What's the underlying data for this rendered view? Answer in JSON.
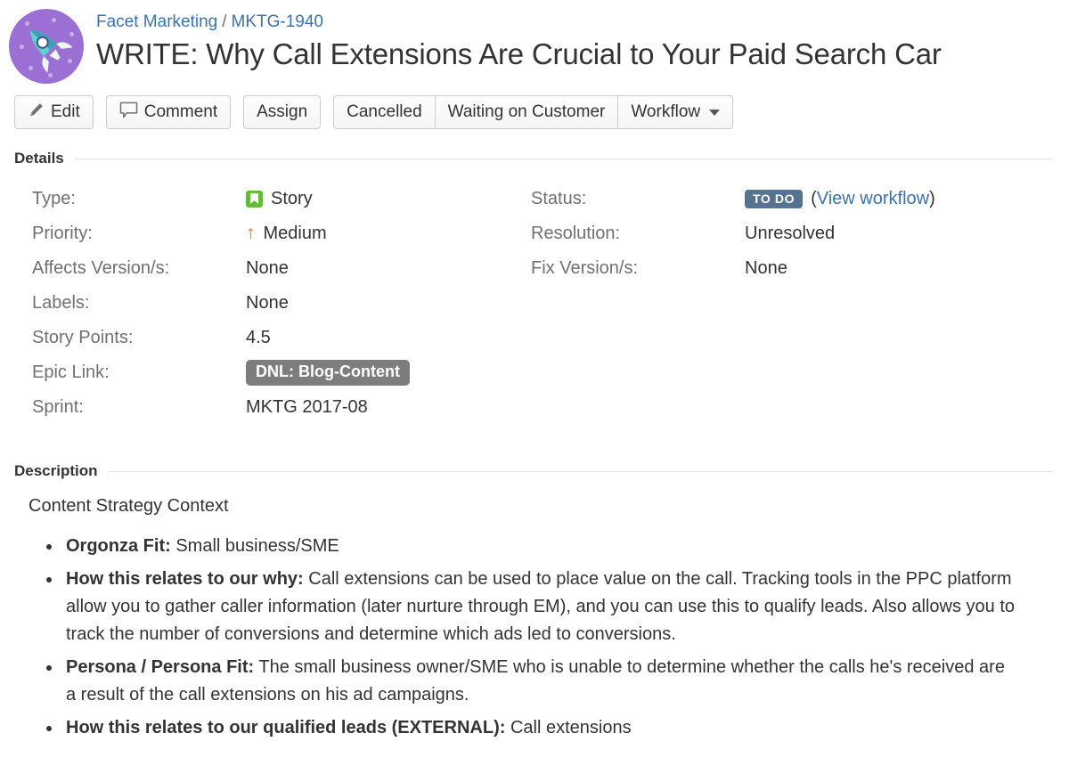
{
  "header": {
    "avatar_icon": "rocket-avatar-icon",
    "breadcrumb": {
      "project": "Facet Marketing",
      "separator": "/",
      "issue_key": "MKTG-1940"
    },
    "title": "WRITE: Why Call Extensions Are Crucial to Your Paid Search Car"
  },
  "toolbar": {
    "edit_label": "Edit",
    "edit_icon": "pencil-icon",
    "comment_label": "Comment",
    "comment_icon": "speech-bubble-icon",
    "assign_label": "Assign",
    "cancelled_label": "Cancelled",
    "waiting_label": "Waiting on Customer",
    "workflow_label": "Workflow",
    "workflow_caret_icon": "chevron-down-icon"
  },
  "details": {
    "heading": "Details",
    "left": [
      {
        "label": "Type:",
        "value": "Story",
        "icon": "story-icon"
      },
      {
        "label": "Priority:",
        "value": "Medium",
        "icon": "arrow-up-icon"
      },
      {
        "label": "Affects Version/s:",
        "value": "None"
      },
      {
        "label": "Labels:",
        "value": "None"
      },
      {
        "label": "Story Points:",
        "value": "4.5"
      },
      {
        "label": "Epic Link:",
        "value": "DNL: Blog-Content",
        "style": "lozenge"
      },
      {
        "label": "Sprint:",
        "value": "MKTG 2017-08"
      }
    ],
    "right": [
      {
        "label": "Status:",
        "value": "TO DO",
        "style": "lozenge",
        "suffix_open": "(",
        "link": "View workflow",
        "suffix_close": ")"
      },
      {
        "label": "Resolution:",
        "value": "Unresolved"
      },
      {
        "label": "Fix Version/s:",
        "value": "None"
      }
    ]
  },
  "description": {
    "heading": "Description",
    "intro": "Content Strategy Context",
    "bullets": [
      {
        "bold": "Orgonza Fit:",
        "text": " Small business/SME"
      },
      {
        "bold": "How this relates to our why:",
        "text": " Call extensions can be used to place value on the call. Tracking tools in the PPC platform allow you to gather caller information (later nurture through EM), and you can use this to qualify leads. Also allows you to track the number of conversions and determine which ads led to conversions."
      },
      {
        "bold": "Persona / Persona Fit:",
        "text": " The small business owner/SME who is unable to determine whether the calls he's received are a result of the call extensions on his ad campaigns."
      },
      {
        "bold": "How this relates to our qualified leads (EXTERNAL):",
        "text": " Call extensions"
      }
    ]
  },
  "colors": {
    "link": "#3b73af",
    "label_gray": "#707070",
    "status_lozenge": "#55738f",
    "epic_lozenge": "#7d7d7d",
    "story_green": "#64ba3b",
    "priority_orange": "#e8711a",
    "avatar_purple": "#9b6fd4"
  }
}
